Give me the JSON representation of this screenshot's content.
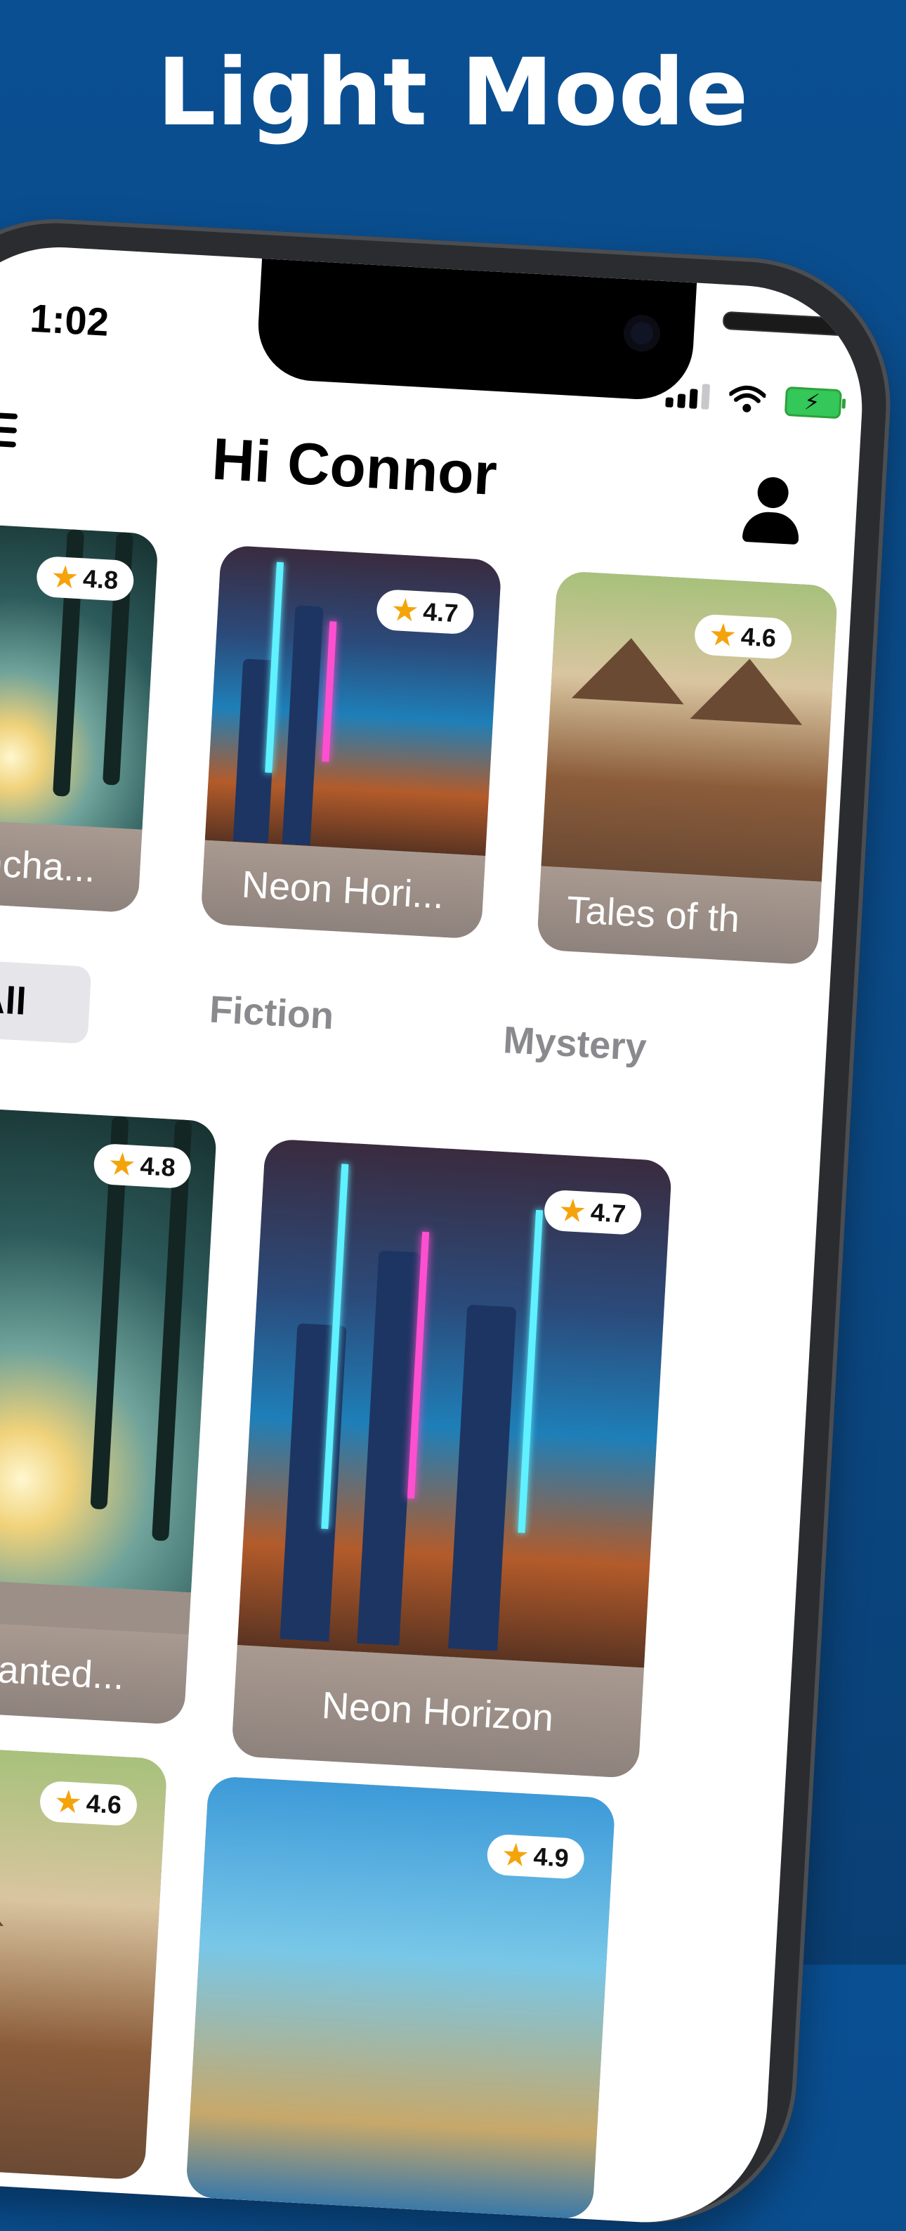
{
  "banner": {
    "headline": "Light Mode"
  },
  "status_bar": {
    "time": "1:02"
  },
  "header": {
    "greeting": "Hi Connor"
  },
  "carousel": [
    {
      "title": "e Encha...",
      "rating": "4.8",
      "image": "forest"
    },
    {
      "title": "Neon Hori...",
      "rating": "4.7",
      "image": "neon"
    },
    {
      "title": "Tales of th",
      "rating": "4.6",
      "image": "village"
    }
  ],
  "tabs": [
    {
      "label": "All",
      "active": true
    },
    {
      "label": "Fiction",
      "active": false
    },
    {
      "label": "Mystery",
      "active": false
    }
  ],
  "grid": [
    {
      "title": "Enchanted...",
      "rating": "4.8",
      "image": "forest"
    },
    {
      "title": "Neon Horizon",
      "rating": "4.7",
      "image": "neon"
    },
    {
      "title": "",
      "rating": "4.6",
      "image": "village"
    },
    {
      "title": "",
      "rating": "4.9",
      "image": "palace"
    }
  ],
  "colors": {
    "banner_bg": "#0b4a86",
    "accent_star": "#f5a30a",
    "tab_active_bg": "#e5e5ea",
    "tab_inactive_text": "#8a8a8e"
  },
  "icons": [
    "menu-icon",
    "user-icon",
    "signal-icon",
    "wifi-icon",
    "battery-icon",
    "star-icon"
  ]
}
